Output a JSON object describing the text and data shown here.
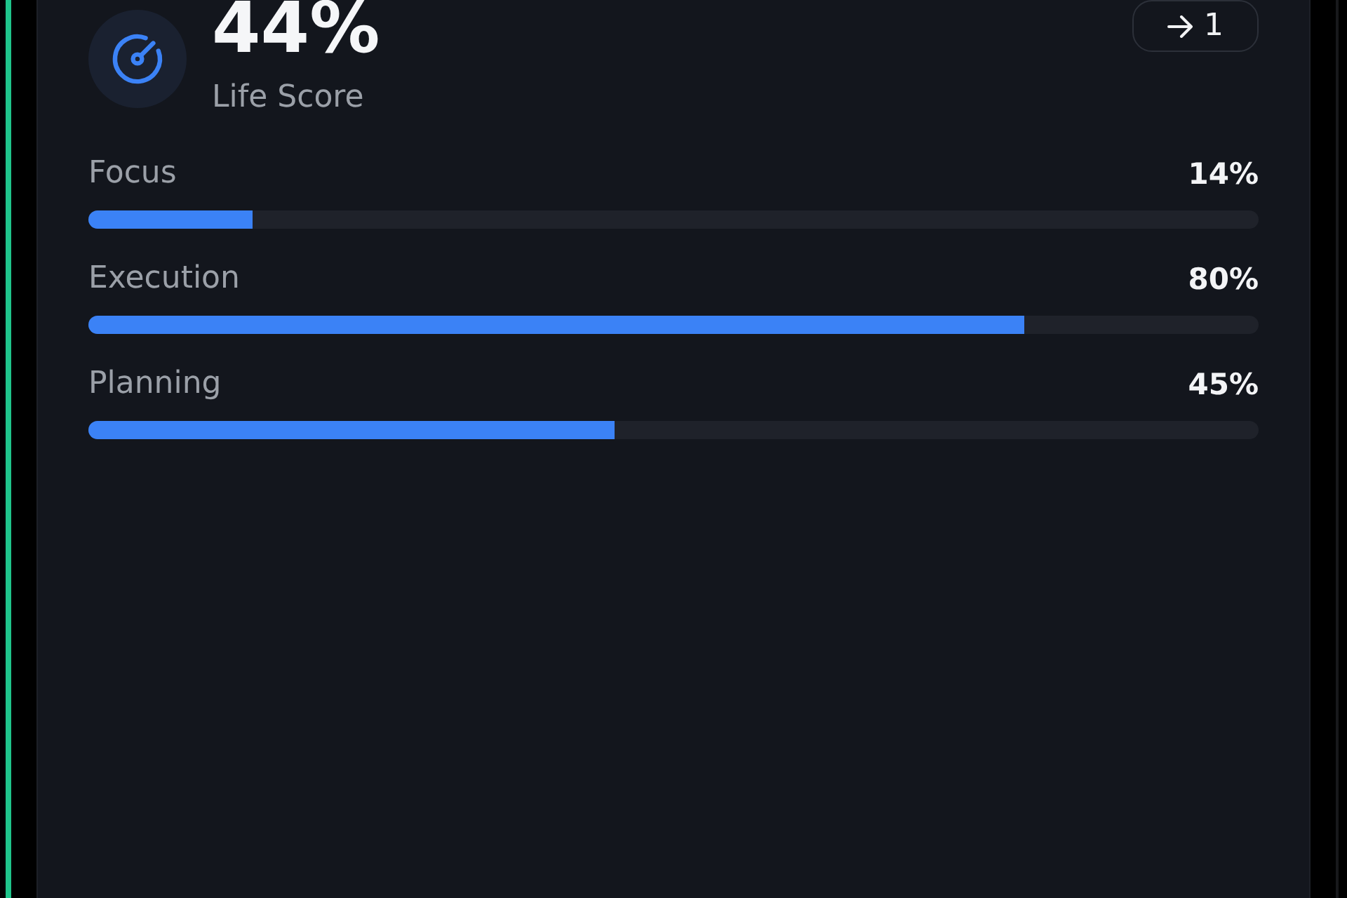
{
  "score": {
    "value": "44%",
    "label": "Life Score"
  },
  "action_button": {
    "label": "1"
  },
  "metrics": [
    {
      "name": "Focus",
      "reading": "14%",
      "level": 0.14
    },
    {
      "name": "Execution",
      "reading": "80%",
      "level": 0.8
    },
    {
      "name": "Planning",
      "reading": "45%",
      "level": 0.45
    }
  ]
}
